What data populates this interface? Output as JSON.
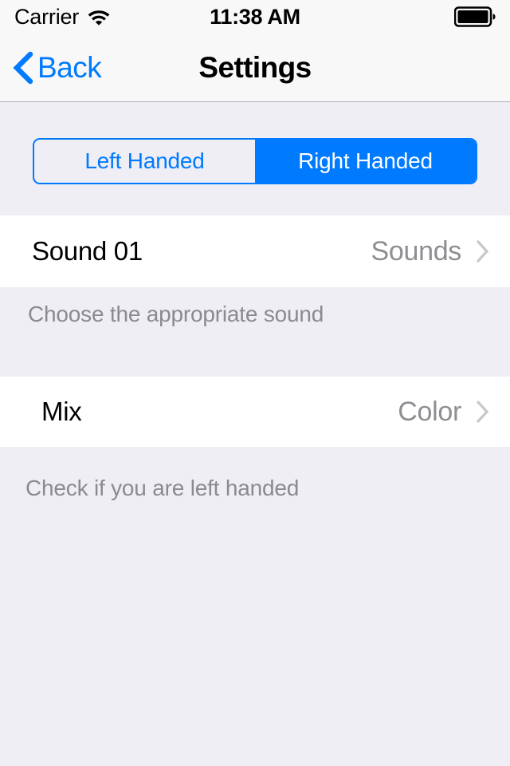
{
  "status_bar": {
    "carrier": "Carrier",
    "wifi_icon": "wifi-icon",
    "time": "11:38 AM",
    "battery_icon": "battery-full-icon"
  },
  "nav_bar": {
    "back_label": "Back",
    "back_icon": "chevron-left-icon",
    "title": "Settings"
  },
  "segmented_control": {
    "options": [
      {
        "label": "Left Handed",
        "selected": false
      },
      {
        "label": "Right Handed",
        "selected": true
      }
    ]
  },
  "rows": [
    {
      "title": "Sound 01",
      "value": "Sounds",
      "disclosure_icon": "chevron-right-icon",
      "footer": "Choose the appropriate sound"
    },
    {
      "title": "Mix",
      "value": "Color",
      "disclosure_icon": "chevron-right-icon",
      "footer": "Check if you are left handed"
    }
  ],
  "colors": {
    "accent_blue": "#007AFF",
    "group_background": "#EFEEF4",
    "row_background": "#FFFFFF",
    "nav_background": "#F8F8F8",
    "secondary_text": "#8E8E93",
    "footer_text": "#8A8A8F"
  }
}
